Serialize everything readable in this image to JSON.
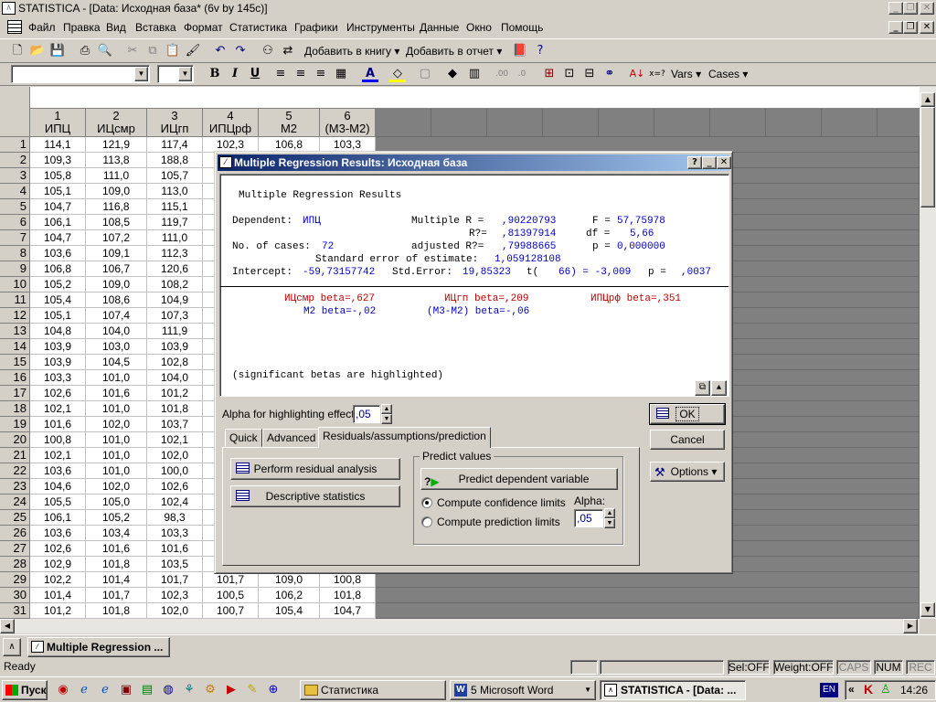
{
  "window": {
    "title": "STATISTICA - [Data: Исходная база* (6v by 145c)]"
  },
  "menu": [
    "Файл",
    "Правка",
    "Вид",
    "Вставка",
    "Формат",
    "Статистика",
    "Графики",
    "Инструменты",
    "Данные",
    "Окно",
    "Помощь"
  ],
  "toolbar": {
    "add_to_book": "Добавить в книгу",
    "add_to_report": "Добавить в отчет",
    "vars": "Vars",
    "cases": "Cases",
    "font_bold": "B",
    "font_italic": "I",
    "font_underline": "U"
  },
  "columns": [
    {
      "num": "1",
      "name": "ИПЦ"
    },
    {
      "num": "2",
      "name": "ИЦсмр"
    },
    {
      "num": "3",
      "name": "ИЦгп"
    },
    {
      "num": "4",
      "name": "ИПЦрф"
    },
    {
      "num": "5",
      "name": "M2"
    },
    {
      "num": "6",
      "name": "(M3-M2)"
    }
  ],
  "rows": [
    {
      "n": "1",
      "v": [
        "114,1",
        "121,9",
        "117,4",
        "102,3",
        "106,8",
        "103,3"
      ]
    },
    {
      "n": "2",
      "v": [
        "109,3",
        "113,8",
        "188,8",
        "",
        "",
        ""
      ]
    },
    {
      "n": "3",
      "v": [
        "105,8",
        "111,0",
        "105,7",
        "",
        "",
        ""
      ]
    },
    {
      "n": "4",
      "v": [
        "105,1",
        "109,0",
        "113,0",
        "",
        "",
        ""
      ]
    },
    {
      "n": "5",
      "v": [
        "104,7",
        "116,8",
        "115,1",
        "",
        "",
        ""
      ]
    },
    {
      "n": "6",
      "v": [
        "106,1",
        "108,5",
        "119,7",
        "",
        "",
        ""
      ]
    },
    {
      "n": "7",
      "v": [
        "104,7",
        "107,2",
        "111,0",
        "",
        "",
        ""
      ]
    },
    {
      "n": "8",
      "v": [
        "103,6",
        "109,1",
        "112,3",
        "",
        "",
        ""
      ]
    },
    {
      "n": "9",
      "v": [
        "106,8",
        "106,7",
        "120,6",
        "",
        "",
        ""
      ]
    },
    {
      "n": "10",
      "v": [
        "105,2",
        "109,0",
        "108,2",
        "",
        "",
        ""
      ]
    },
    {
      "n": "11",
      "v": [
        "105,4",
        "108,6",
        "104,9",
        "",
        "",
        ""
      ]
    },
    {
      "n": "12",
      "v": [
        "105,1",
        "107,4",
        "107,3",
        "",
        "",
        ""
      ]
    },
    {
      "n": "13",
      "v": [
        "104,8",
        "104,0",
        "111,9",
        "",
        "",
        ""
      ]
    },
    {
      "n": "14",
      "v": [
        "103,9",
        "103,0",
        "103,9",
        "",
        "",
        ""
      ]
    },
    {
      "n": "15",
      "v": [
        "103,9",
        "104,5",
        "102,8",
        "",
        "",
        ""
      ]
    },
    {
      "n": "16",
      "v": [
        "103,3",
        "101,0",
        "104,0",
        "",
        "",
        ""
      ]
    },
    {
      "n": "17",
      "v": [
        "102,6",
        "101,6",
        "101,2",
        "",
        "",
        ""
      ]
    },
    {
      "n": "18",
      "v": [
        "102,1",
        "101,0",
        "101,8",
        "",
        "",
        ""
      ]
    },
    {
      "n": "19",
      "v": [
        "101,6",
        "102,0",
        "103,7",
        "",
        "",
        ""
      ]
    },
    {
      "n": "20",
      "v": [
        "100,8",
        "101,0",
        "102,1",
        "",
        "",
        ""
      ]
    },
    {
      "n": "21",
      "v": [
        "102,1",
        "101,0",
        "102,0",
        "",
        "",
        ""
      ]
    },
    {
      "n": "22",
      "v": [
        "103,6",
        "101,0",
        "100,0",
        "",
        "",
        ""
      ]
    },
    {
      "n": "23",
      "v": [
        "104,6",
        "102,0",
        "102,6",
        "",
        "",
        ""
      ]
    },
    {
      "n": "24",
      "v": [
        "105,5",
        "105,0",
        "102,4",
        "",
        "",
        ""
      ]
    },
    {
      "n": "25",
      "v": [
        "106,1",
        "105,2",
        "98,3",
        "",
        "",
        ""
      ]
    },
    {
      "n": "26",
      "v": [
        "103,6",
        "103,4",
        "103,3",
        "",
        "",
        ""
      ]
    },
    {
      "n": "27",
      "v": [
        "102,6",
        "101,6",
        "101,6",
        "",
        "",
        ""
      ]
    },
    {
      "n": "28",
      "v": [
        "102,9",
        "101,8",
        "103,5",
        "",
        "",
        ""
      ]
    },
    {
      "n": "29",
      "v": [
        "102,2",
        "101,4",
        "101,7",
        "101,7",
        "109,0",
        "100,8"
      ]
    },
    {
      "n": "30",
      "v": [
        "101,4",
        "101,7",
        "102,3",
        "100,5",
        "106,2",
        "101,8"
      ]
    },
    {
      "n": "31",
      "v": [
        "101,2",
        "101,8",
        "102,0",
        "100,7",
        "105,4",
        "104,7"
      ]
    }
  ],
  "dialog": {
    "title": "Multiple Regression Results: Исходная база",
    "heading": "Multiple Regression Results",
    "dependent_label": "Dependent:",
    "dependent_value": "ИПЦ",
    "multiple_r_label": "Multiple R =",
    "multiple_r": ",90220793",
    "f_label": "F =",
    "f": "57,75978",
    "r2_label": "R?=",
    "r2": ",81397914",
    "df_label": "df =",
    "df": "5,66",
    "cases_label": "No. of cases:",
    "cases": "72",
    "adj_r2_label": "adjusted R?=",
    "adj_r2": ",79988665",
    "p_label": "p =",
    "p": "0,000000",
    "se_label": "Standard error of estimate:",
    "se": "1,059128108",
    "intercept_label": "Intercept:",
    "intercept": "-59,73157742",
    "stderr_label": "Std.Error:",
    "stderr": "19,85323",
    "t_label": "t(",
    "t_df": "66) = -3,009",
    "p2_label": "p =",
    "p2": ",0037",
    "beta1": "ИЦсмр beta=,627",
    "beta2": "ИЦгп beta=,209",
    "beta3": "ИПЦрф beta=,351",
    "beta4": "M2 beta=-,02",
    "beta5": "(M3-M2) beta=-,06",
    "note": "(significant betas are highlighted)",
    "alpha_label": "Alpha for highlighting effects:",
    "alpha_value": ",05",
    "ok": "OK",
    "cancel": "Cancel",
    "options": "Options",
    "tabs": [
      "Quick",
      "Advanced",
      "Residuals/assumptions/prediction"
    ],
    "residual_btn": "Perform residual analysis",
    "descriptive_btn": "Descriptive statistics",
    "predict_group": "Predict values",
    "predict_btn": "Predict dependent variable",
    "confidence": "Compute confidence limits",
    "prediction": "Compute prediction limits",
    "alpha2_label": "Alpha:",
    "alpha2_value": ",05"
  },
  "docbar": {
    "window_label": "Multiple Regression ..."
  },
  "status": {
    "ready": "Ready",
    "sel": "Sel:OFF",
    "weight": "Weight:OFF",
    "caps": "CAPS",
    "num": "NUM",
    "rec": "REC"
  },
  "taskbar": {
    "start": "Пуск",
    "t1": "Статистика",
    "t2": "5 Microsoft Word",
    "t3": "STATISTICA - [Data: ...",
    "lang": "EN",
    "clock": "14:26"
  }
}
